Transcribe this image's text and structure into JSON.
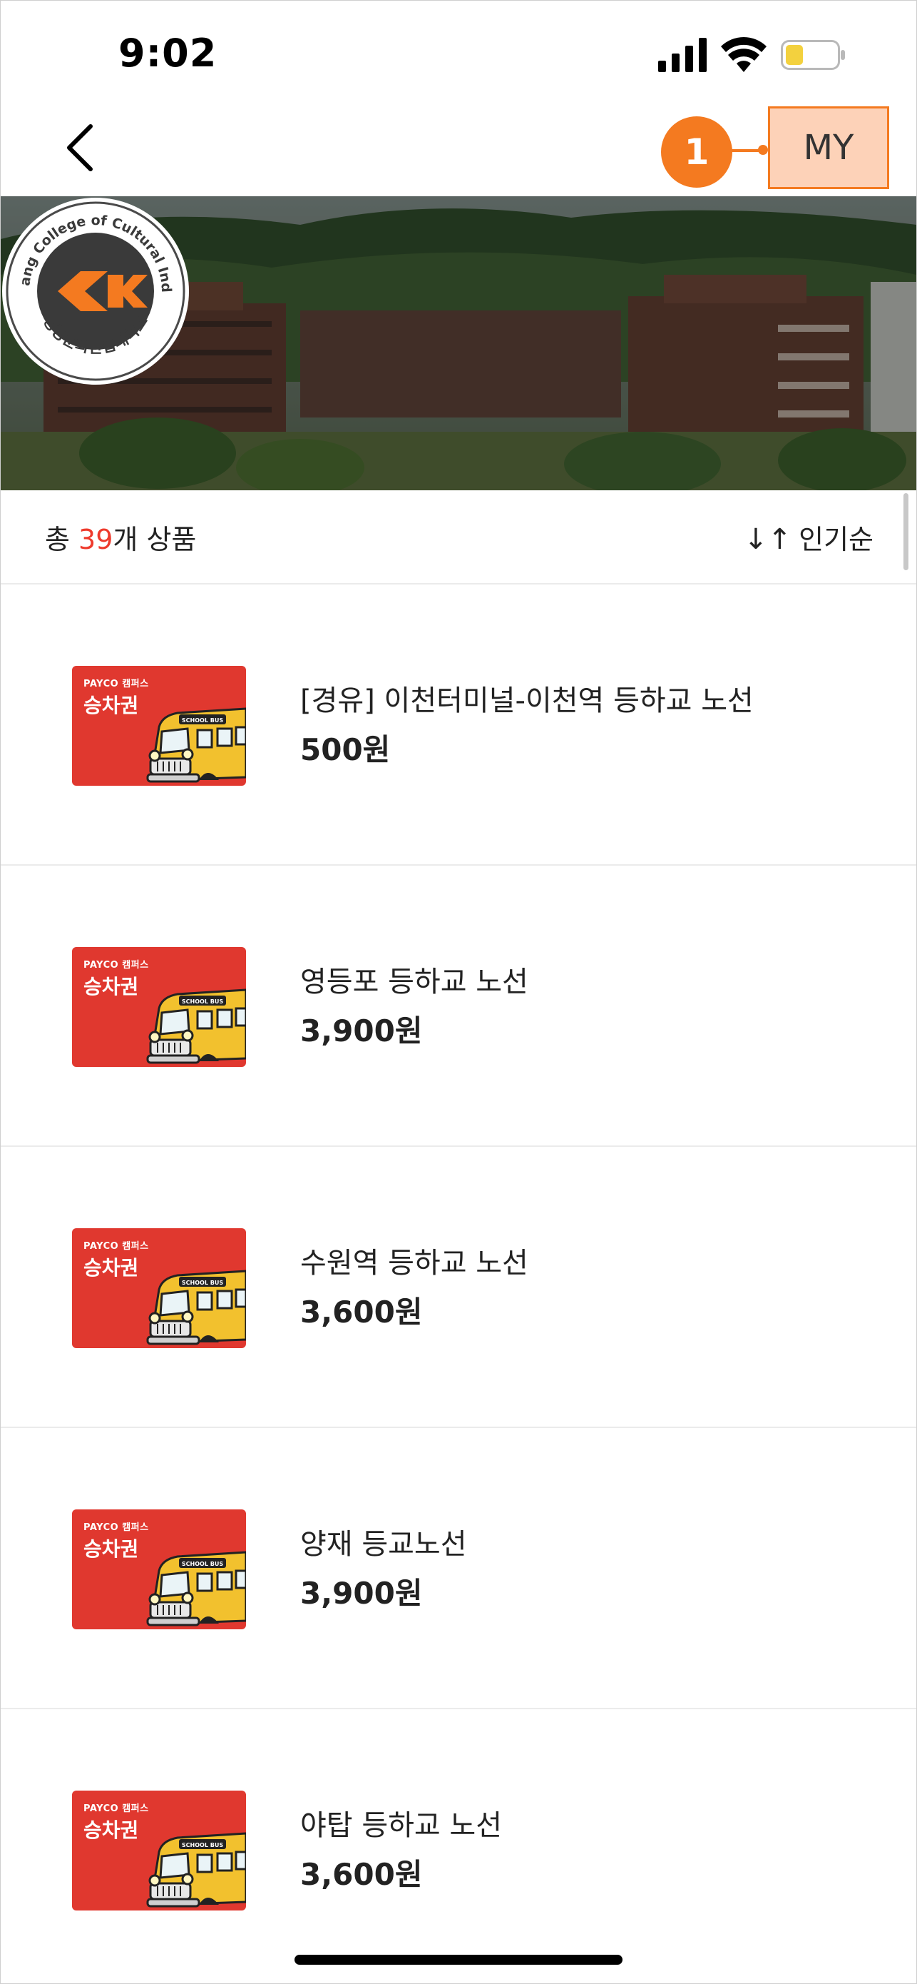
{
  "status_bar": {
    "time": "9:02"
  },
  "nav": {
    "back_icon": "chevron-left-icon",
    "callout_number": "1",
    "my_label": "MY"
  },
  "banner": {
    "logo_ring_text": "ChungKang College of Cultural Industries",
    "logo_korean_text": "청강문화산업대학교",
    "accent_color": "#f47a20"
  },
  "list_header": {
    "total_prefix": "총 ",
    "total_count": "39",
    "total_suffix": "개 상품",
    "sort_icon": "sort-arrows-icon",
    "sort_label": "인기순"
  },
  "ticket_card": {
    "brand": "PAYCO 캠퍼스",
    "title": "승차권",
    "bus_text": "SCHOOL BUS"
  },
  "products": [
    {
      "name": "[경유] 이천터미널-이천역 등하교 노선",
      "price": "500원"
    },
    {
      "name": "영등포 등하교 노선",
      "price": "3,900원"
    },
    {
      "name": "수원역 등하교 노선",
      "price": "3,600원"
    },
    {
      "name": "양재 등교노선",
      "price": "3,900원"
    },
    {
      "name": "야탑 등하교 노선",
      "price": "3,600원"
    }
  ]
}
